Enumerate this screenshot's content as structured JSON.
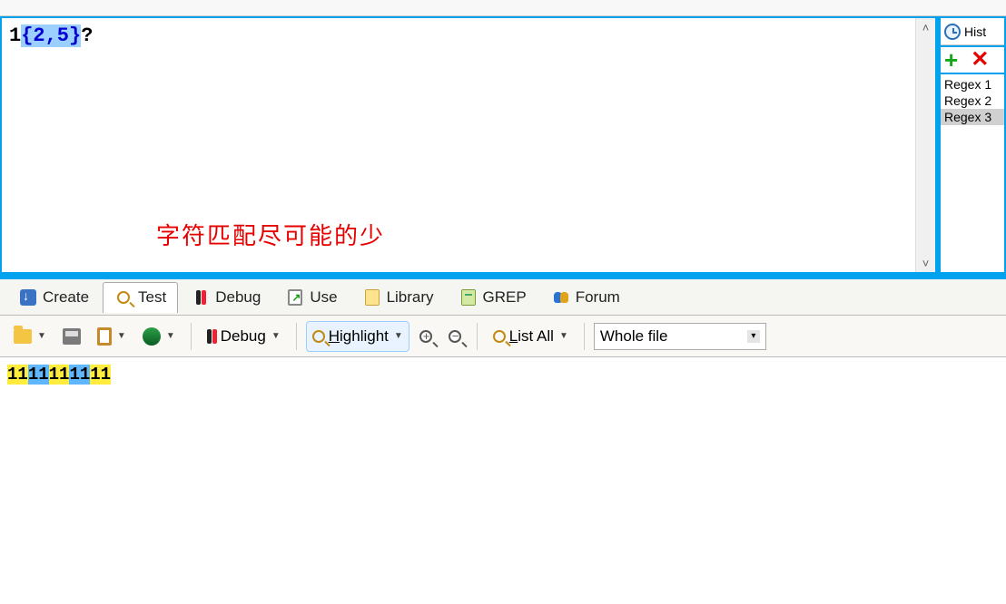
{
  "regex_editor": {
    "line_prefix": "1",
    "quantifier": "{2,5}",
    "suffix": "?"
  },
  "annotation": "字符匹配尽可能的少",
  "history": {
    "header_label": "Hist",
    "items": [
      "Regex 1",
      "Regex 2",
      "Regex 3"
    ],
    "selected_index": 2
  },
  "tabs": {
    "create": "Create",
    "test": "Test",
    "debug": "Debug",
    "use": "Use",
    "library": "Library",
    "grep": "GREP",
    "forum": "Forum",
    "active": "test"
  },
  "toolbar": {
    "debug_label": "Debug",
    "highlight_label": "Highlight",
    "list_all_label": "List All",
    "scope_value": "Whole file"
  },
  "result": {
    "text": "1111111111",
    "segments": [
      {
        "t": "11",
        "alt": false
      },
      {
        "t": "11",
        "alt": true
      },
      {
        "t": "11",
        "alt": false
      },
      {
        "t": "11",
        "alt": true
      },
      {
        "t": "11",
        "alt": false
      }
    ]
  }
}
